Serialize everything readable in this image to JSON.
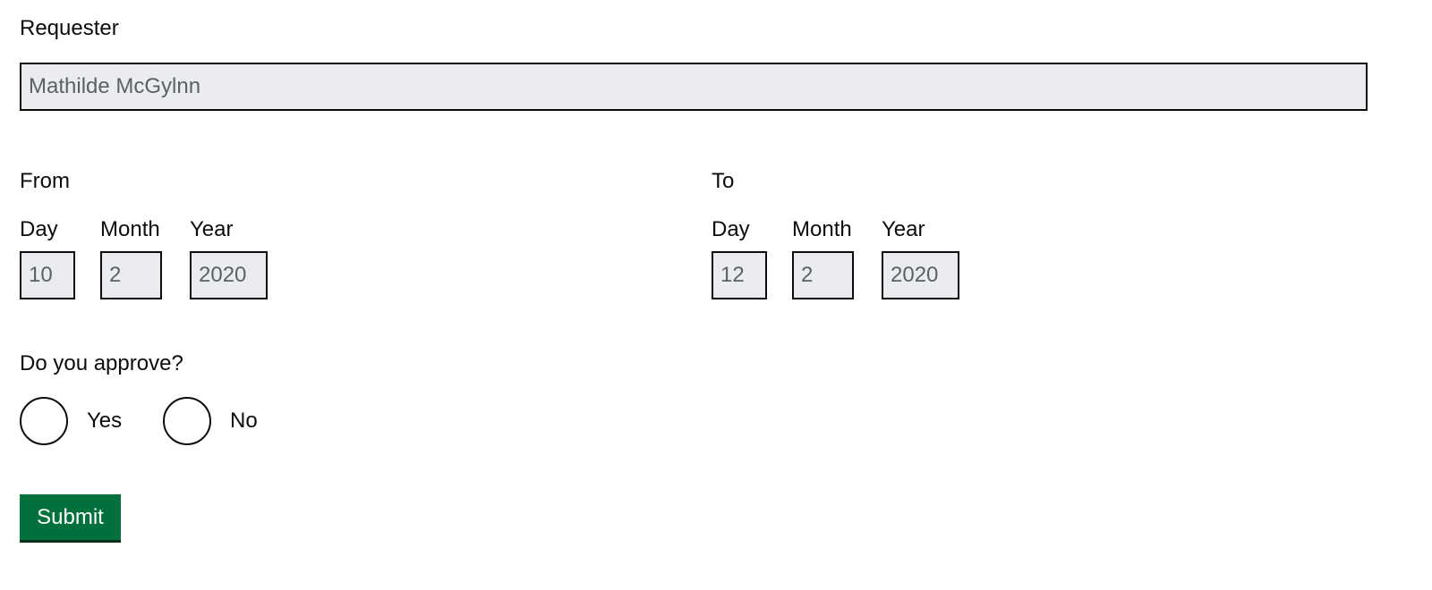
{
  "requester": {
    "label": "Requester",
    "value": "Mathilde McGylnn"
  },
  "from": {
    "label": "From",
    "day_label": "Day",
    "month_label": "Month",
    "year_label": "Year",
    "day": "10",
    "month": "2",
    "year": "2020"
  },
  "to": {
    "label": "To",
    "day_label": "Day",
    "month_label": "Month",
    "year_label": "Year",
    "day": "12",
    "month": "2",
    "year": "2020"
  },
  "approval": {
    "question": "Do you approve?",
    "options": [
      "Yes",
      "No"
    ]
  },
  "submit_label": "Submit",
  "colors": {
    "input_background": "#ebecef",
    "input_text": "#5c6168",
    "border": "#0b0c0c",
    "submit_background": "#00703c",
    "submit_text": "#ffffff"
  }
}
